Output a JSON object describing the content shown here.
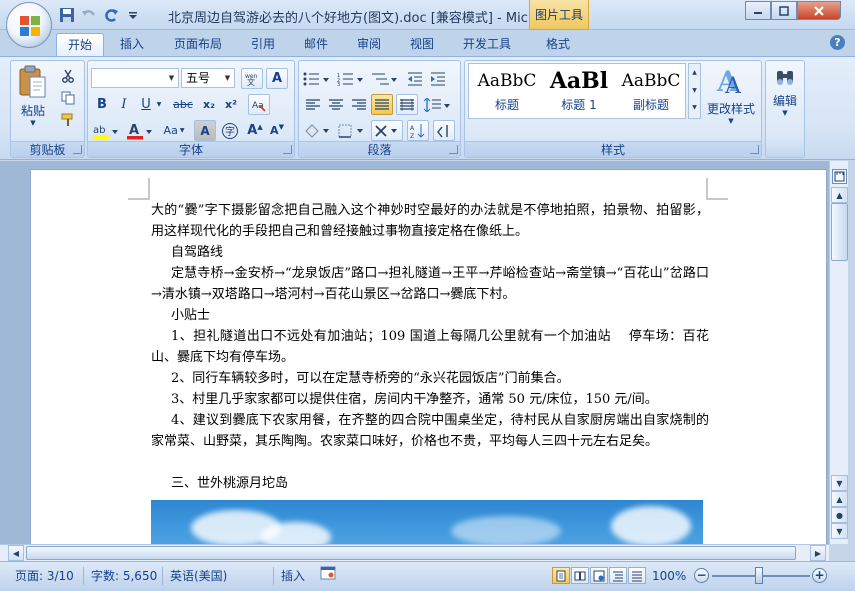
{
  "window": {
    "title": "北京周边自驾游必去的八个好地方(图文).doc [兼容模式] - Mic...",
    "context_tab_title": "图片工具",
    "controls": {
      "minimize": "minimize",
      "maximize": "maximize",
      "close": "close"
    }
  },
  "quick_access": [
    "save-icon",
    "undo-icon",
    "redo-icon",
    "customize-icon"
  ],
  "tabs": [
    {
      "label": "开始",
      "active": true
    },
    {
      "label": "插入"
    },
    {
      "label": "页面布局"
    },
    {
      "label": "引用"
    },
    {
      "label": "邮件"
    },
    {
      "label": "审阅"
    },
    {
      "label": "视图"
    },
    {
      "label": "开发工具"
    },
    {
      "label": "格式"
    }
  ],
  "ribbon": {
    "clipboard": {
      "label": "剪贴板",
      "paste": "粘贴"
    },
    "font": {
      "label": "字体",
      "font_name": "",
      "font_size": "五号",
      "buttons": {
        "bold": "B",
        "italic": "I",
        "underline": "U",
        "strikethrough": "abc",
        "subscript": "x₂",
        "superscript": "x²",
        "change_case": "Aa",
        "grow": "A",
        "shrink": "A"
      },
      "highlight_color": "#ffff00",
      "font_color": "#e02020"
    },
    "paragraph": {
      "label": "段落"
    },
    "styles": {
      "label": "样式",
      "items": [
        {
          "sample": "AaBbC",
          "name": "标题"
        },
        {
          "sample": "AaBl",
          "name": "标题 1"
        },
        {
          "sample": "AaBbC",
          "name": "副标题"
        }
      ],
      "change_styles": "更改样式"
    },
    "editing": {
      "label": "编辑"
    }
  },
  "document": {
    "paragraphs": [
      {
        "text": "大的“爨”字下摄影留念把自己融入这个神妙时空最好的办法就是不停地拍照，拍景物、拍留影，用这样现代化的手段把自己和曾经接触过事物直接定格在像纸上。",
        "indent": false
      },
      {
        "text": "自驾路线",
        "indent": true
      },
      {
        "text": "定慧寺桥→金安桥→“龙泉饭店”路口→担礼隧道→王平→芹峪检查站→斋堂镇→“百花山”岔路口→清水镇→双塔路口→塔河村→百花山景区→岔路口→爨底下村。",
        "indent": true
      },
      {
        "text": "小贴士",
        "indent": true
      },
      {
        "text": "1、担礼隧道出口不远处有加油站；109 国道上每隔几公里就有一个加油站　 停车场：百花山、爨底下均有停车场。",
        "indent": true
      },
      {
        "text": "2、同行车辆较多时，可以在定慧寺桥旁的“永兴花园饭店”门前集合。",
        "indent": true
      },
      {
        "text": "3、村里几乎家家都可以提供住宿，房间内干净整齐，通常 50 元/床位，150 元/间。",
        "indent": true
      },
      {
        "text": "4、建议到爨底下农家用餐，在齐整的四合院中围桌坐定，待村民从自家厨房端出自家烧制的家常菜、山野菜，其乐陶陶。农家菜口味好，价格也不贵，平均每人三四十元左右足矣。",
        "indent": true
      },
      {
        "text": "",
        "indent": false
      },
      {
        "text": "三、世外桃源月坨岛",
        "indent": true
      }
    ]
  },
  "status": {
    "page": "页面: 3/10",
    "words": "字数: 5,650",
    "language": "英语(美国)",
    "mode": "插入",
    "zoom": "100%",
    "zoom_level": 1.0
  }
}
